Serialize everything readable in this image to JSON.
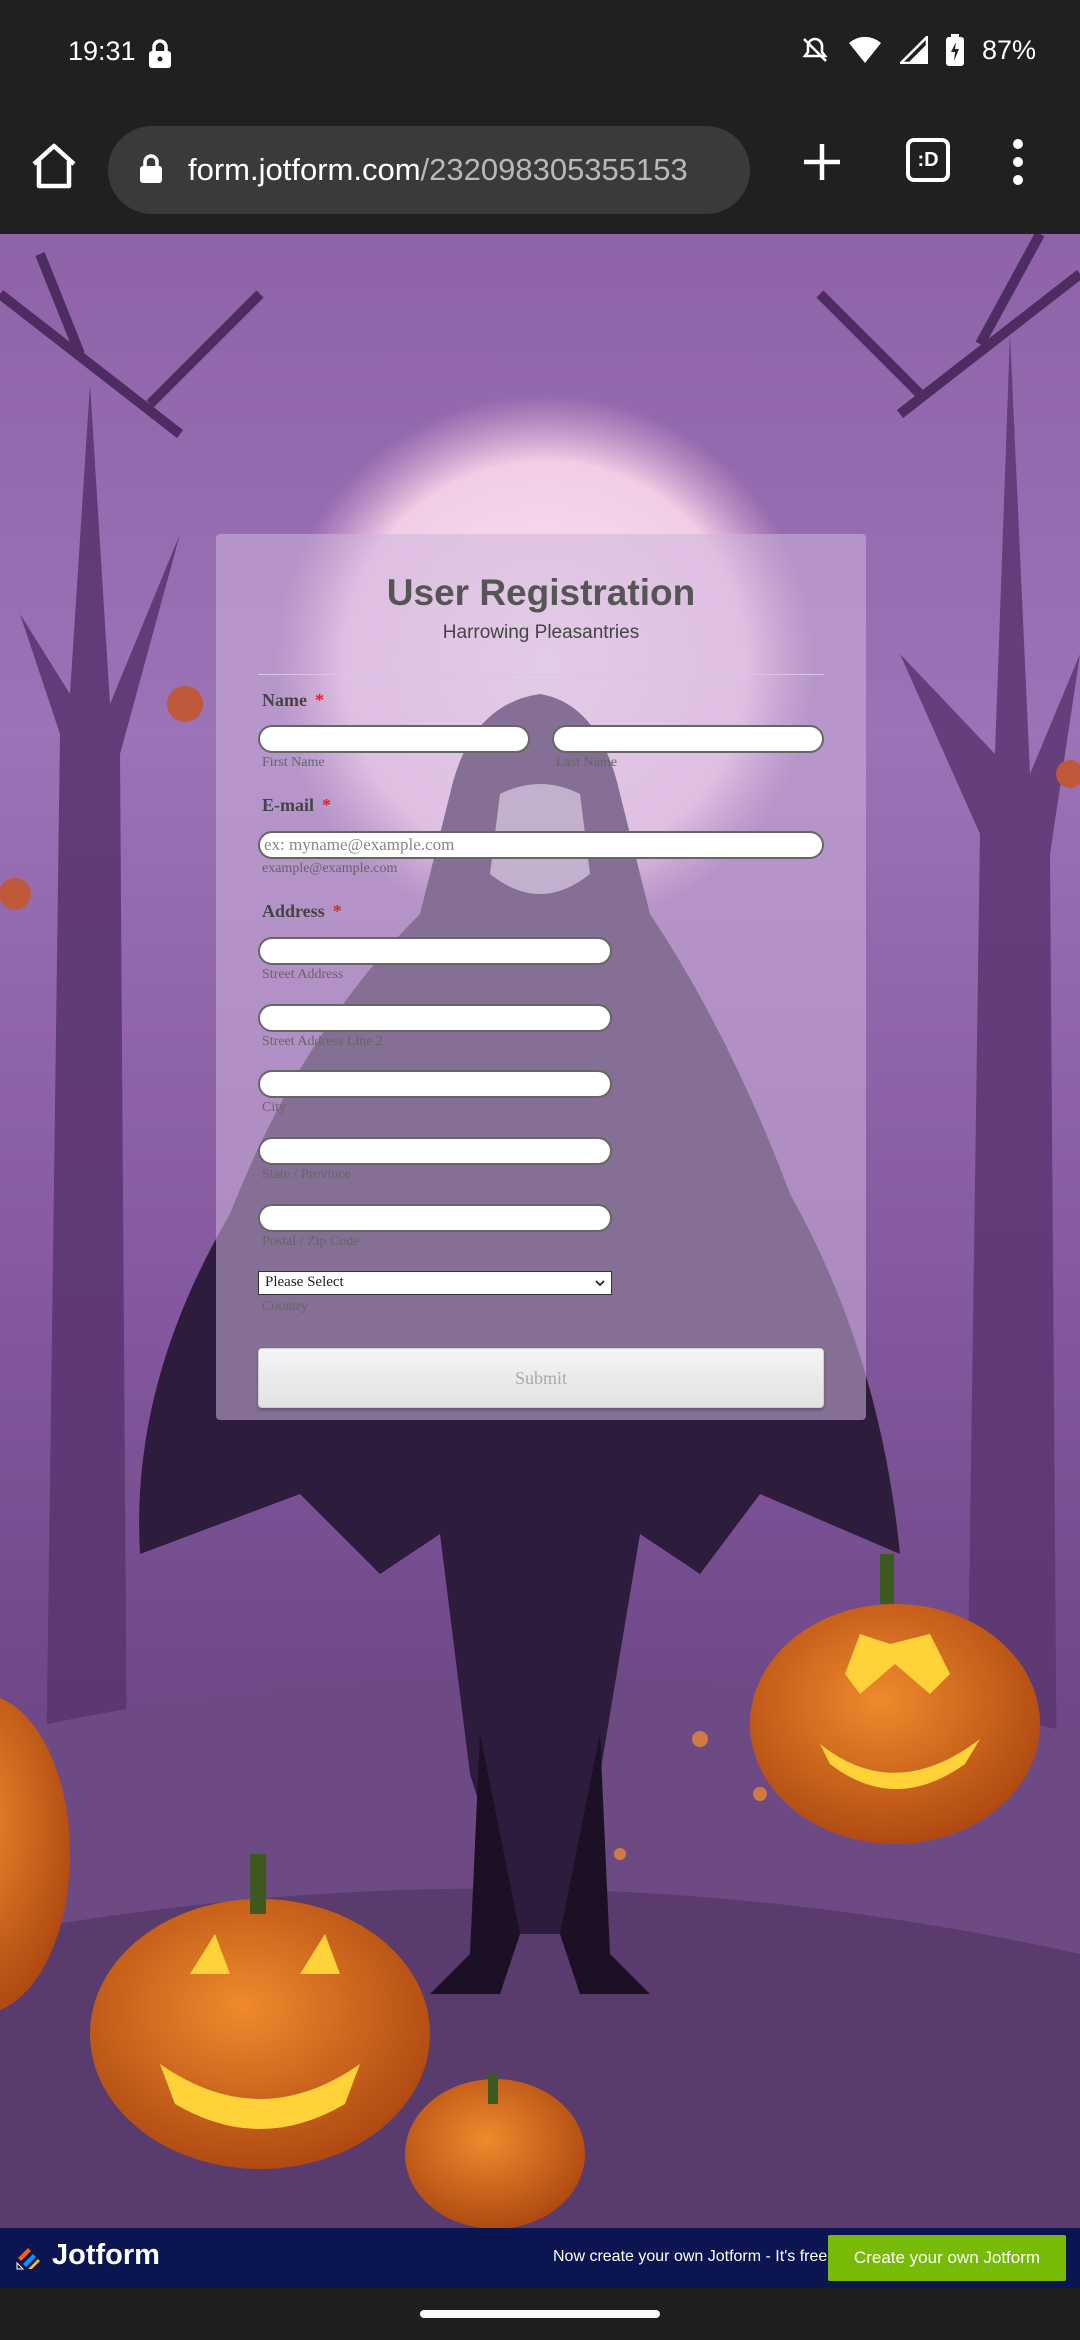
{
  "status_bar": {
    "time": "19:31",
    "battery": "87%"
  },
  "browser": {
    "url_host": "form.jotform.com",
    "url_path": "/232098305355153",
    "tab_switcher_label": ":D"
  },
  "form": {
    "title": "User Registration",
    "subtitle": "Harrowing Pleasantries",
    "name_label": "Name",
    "required_mark": "*",
    "first_name_sub": "First Name",
    "last_name_sub": "Last Name",
    "email_label": "E-mail",
    "email_placeholder": "ex: myname@example.com",
    "email_sub": "example@example.com",
    "address_label": "Address",
    "street_sub": "Street Address",
    "street2_sub": "Street Address Line 2",
    "city_sub": "City",
    "state_sub": "State / Province",
    "postal_sub": "Postal / Zip Code",
    "country_selected": "Please Select",
    "country_sub": "Country",
    "submit_label": "Submit"
  },
  "footer": {
    "brand": "Jotform",
    "promo": "Now create your own Jotform - It's free!",
    "cta": "Create your own Jotform"
  },
  "colors": {
    "required": "#e02424",
    "footer_bg": "#0a1551",
    "cta_bg": "#78bb07"
  }
}
